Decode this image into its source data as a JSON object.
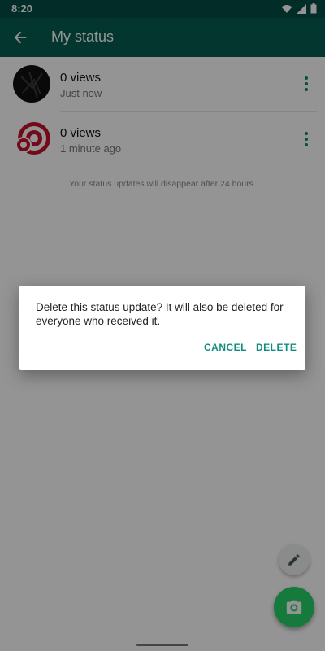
{
  "status_bar": {
    "time": "8:20",
    "icons": [
      "wifi-icon",
      "signal-icon",
      "battery-icon"
    ]
  },
  "app_bar": {
    "title": "My status",
    "back_icon": "arrow-back-icon"
  },
  "status_updates": [
    {
      "views": "0 views",
      "time": "Just now"
    },
    {
      "views": "0 views",
      "time": "1 minute ago"
    }
  ],
  "footnote": "Your status updates will disappear after 24 hours.",
  "fabs": {
    "small_icon": "pencil-icon",
    "main_icon": "camera-icon"
  },
  "dialog": {
    "message": "Delete this status update? It will also be deleted for everyone who received it.",
    "cancel_label": "CANCEL",
    "delete_label": "DELETE"
  },
  "colors": {
    "primary": "#075e54",
    "status_bar": "#054c44",
    "accent": "#25d366",
    "button_text": "#128c7e",
    "menu_dots": "#0f8a5f"
  }
}
